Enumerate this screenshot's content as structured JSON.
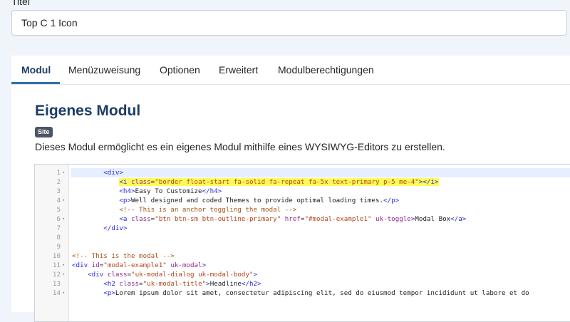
{
  "title_field": {
    "label": "Titel",
    "value": "Top C 1 Icon"
  },
  "tabs": [
    {
      "label": "Modul",
      "active": true
    },
    {
      "label": "Menüzuweisung",
      "active": false
    },
    {
      "label": "Optionen",
      "active": false
    },
    {
      "label": "Erweitert",
      "active": false
    },
    {
      "label": "Modulberechtigungen",
      "active": false
    }
  ],
  "module": {
    "heading": "Eigenes Modul",
    "badge": "Site",
    "description": "Dieses Modul ermöglicht es ein eigenes Modul mithilfe eines WYSIWYG-Editors zu erstellen."
  },
  "editor": {
    "lines": [
      {
        "num": "1",
        "fold": "▾",
        "code": "        <div>"
      },
      {
        "num": "2",
        "fold": "",
        "code": "            <i class=\"border float-start fa-solid fa-repeat fa-5x text-primary p-5 me-4\"></i>"
      },
      {
        "num": "3",
        "fold": "",
        "code": "            <h4>Easy To Customize</h4>"
      },
      {
        "num": "4",
        "fold": "▾",
        "code": "            <p>Well designed and coded Themes to provide optimal loading times.</p>"
      },
      {
        "num": "5",
        "fold": "",
        "code": "            <!-- This is an anchor toggling the modal -->"
      },
      {
        "num": "6",
        "fold": "▾",
        "code": "            <a class=\"btn btn-sm btn-outline-primary\" href=\"#modal-example1\" uk-toggle>Modal Box</a>"
      },
      {
        "num": "7",
        "fold": "",
        "code": "        </div>"
      },
      {
        "num": "8",
        "fold": "",
        "code": ""
      },
      {
        "num": "9",
        "fold": "",
        "code": ""
      },
      {
        "num": "10",
        "fold": "",
        "code": "<!-- This is the modal -->"
      },
      {
        "num": "11",
        "fold": "▾",
        "code": "<div id=\"modal-example1\" uk-modal>"
      },
      {
        "num": "12",
        "fold": "▾",
        "code": "    <div class=\"uk-modal-dialog uk-modal-body\">"
      },
      {
        "num": "13",
        "fold": "",
        "code": "        <h2 class=\"uk-modal-title\">Headline</h2>"
      },
      {
        "num": "14",
        "fold": "▾",
        "code": "        <p>Lorem ipsum dolor sit amet, consectetur adipiscing elit, sed do eiusmod tempor incididunt ut labore et do"
      }
    ]
  }
}
